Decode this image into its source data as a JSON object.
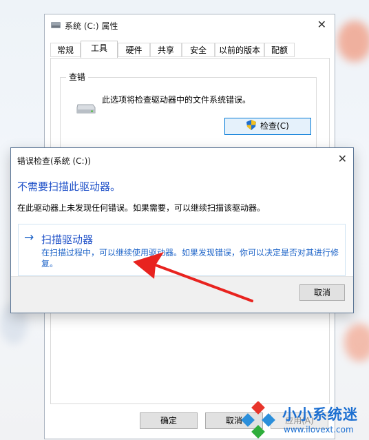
{
  "properties_window": {
    "title": "系统 (C:) 属性",
    "tabs": [
      "常规",
      "工具",
      "硬件",
      "共享",
      "安全",
      "以前的版本",
      "配额"
    ],
    "active_tab": "工具",
    "error_checking": {
      "group_label": "查错",
      "description": "此选项将检查驱动器中的文件系统错误。",
      "check_button": "检查(C)"
    },
    "buttons": {
      "ok": "确定",
      "cancel": "取消",
      "apply": "应用(A)"
    }
  },
  "dialog": {
    "title": "错误检查(系统 (C:))",
    "heading": "不需要扫描此驱动器。",
    "description": "在此驱动器上未发现任何错误。如果需要，可以继续扫描该驱动器。",
    "scan_option": {
      "arrow": "→",
      "title": "扫描驱动器",
      "description": "在扫描过程中，可以继续使用驱动器。如果发现错误，你可以决定是否对其进行修复。"
    },
    "cancel_button": "取消"
  },
  "watermark": {
    "text": "小小系统迷",
    "url": "www.ilovext.com"
  },
  "colors": {
    "accent_blue": "#1e50c8",
    "annotation_red": "#e8231f",
    "watermark_blue": "#1c6fd1"
  },
  "icons": [
    "drive-icon",
    "shield-icon",
    "close-icon",
    "arrow-right-icon",
    "app-icon",
    "watermark-logo-icon"
  ]
}
